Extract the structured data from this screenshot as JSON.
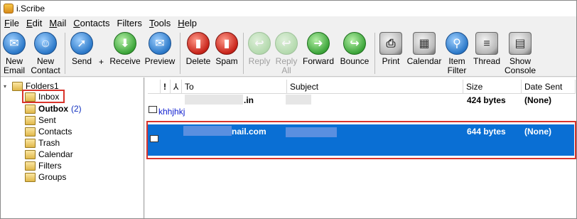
{
  "window": {
    "title": "i.Scribe"
  },
  "menu": [
    {
      "label": "File",
      "hotkey": "F",
      "rest": "ile"
    },
    {
      "label": "Edit",
      "hotkey": "E",
      "rest": "dit"
    },
    {
      "label": "Mail",
      "hotkey": "M",
      "rest": "ail"
    },
    {
      "label": "Contacts",
      "hotkey": "C",
      "rest": "ontacts"
    },
    {
      "label": "Filters",
      "hotkey": "",
      "rest": "Filters"
    },
    {
      "label": "Tools",
      "hotkey": "T",
      "rest": "ools"
    },
    {
      "label": "Help",
      "hotkey": "H",
      "rest": "elp"
    }
  ],
  "toolbar": {
    "new_email": {
      "line1": "New",
      "line2": "Email",
      "icon": "new-email-icon"
    },
    "new_contact": {
      "line1": "New",
      "line2": "Contact",
      "icon": "new-contact-icon"
    },
    "send": {
      "line1": "Send",
      "line2": "",
      "icon": "send-icon"
    },
    "plus": "+",
    "receive": {
      "line1": "Receive",
      "line2": "",
      "icon": "receive-icon"
    },
    "preview": {
      "line1": "Preview",
      "line2": "",
      "icon": "preview-icon"
    },
    "delete": {
      "line1": "Delete",
      "line2": "",
      "icon": "delete-icon"
    },
    "spam": {
      "line1": "Spam",
      "line2": "",
      "icon": "spam-icon"
    },
    "reply": {
      "line1": "Reply",
      "line2": "",
      "icon": "reply-icon"
    },
    "reply_all": {
      "line1": "Reply",
      "line2": "All",
      "icon": "reply-all-icon"
    },
    "forward": {
      "line1": "Forward",
      "line2": "",
      "icon": "forward-icon"
    },
    "bounce": {
      "line1": "Bounce",
      "line2": "",
      "icon": "bounce-icon"
    },
    "print": {
      "line1": "Print",
      "line2": "",
      "icon": "print-icon"
    },
    "calendar": {
      "line1": "Calendar",
      "line2": "",
      "icon": "calendar-icon"
    },
    "item_filter": {
      "line1": "Item",
      "line2": "Filter",
      "icon": "item-filter-icon"
    },
    "thread": {
      "line1": "Thread",
      "line2": "",
      "icon": "thread-icon"
    },
    "show_console": {
      "line1": "Show",
      "line2": "Console",
      "icon": "show-console-icon"
    }
  },
  "folders": {
    "root": "Folders1",
    "items": [
      {
        "label": "Inbox",
        "count": ""
      },
      {
        "label": "Outbox",
        "count": "(2)"
      },
      {
        "label": "Sent",
        "count": ""
      },
      {
        "label": "Contacts",
        "count": ""
      },
      {
        "label": "Trash",
        "count": ""
      },
      {
        "label": "Calendar",
        "count": ""
      },
      {
        "label": "Filters",
        "count": ""
      },
      {
        "label": "Groups",
        "count": ""
      }
    ]
  },
  "columns": {
    "flag": "!",
    "attach": "⅄",
    "to": "To",
    "subject": "Subject",
    "size": "Size",
    "date": "Date Sent"
  },
  "messages": [
    {
      "to_suffix": ".in",
      "subject": "",
      "size": "424 bytes",
      "date": "(None)",
      "preview": "khhjhkj"
    },
    {
      "to_suffix": "nail.com",
      "subject": "",
      "size": "644 bytes",
      "date": "(None)",
      "preview": ""
    }
  ],
  "colors": {
    "selection": "#0a6fd4",
    "highlight_box": "#d9342b",
    "count": "#1030c0"
  }
}
